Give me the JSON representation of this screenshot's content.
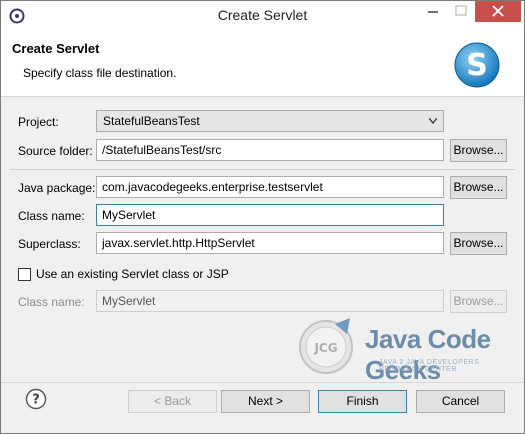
{
  "window": {
    "title": "Create Servlet"
  },
  "banner": {
    "title": "Create Servlet",
    "description": "Specify class file destination."
  },
  "form": {
    "project_label": "Project:",
    "project_value": "StatefulBeansTest",
    "source_folder_label": "Source folder:",
    "source_folder_value": "/StatefulBeansTest/src",
    "java_package_label": "Java package:",
    "java_package_value": "com.javacodegeeks.enterprise.testservlet",
    "class_name_label": "Class name:",
    "class_name_value": "MyServlet",
    "superclass_label": "Superclass:",
    "superclass_value": "javax.servlet.http.HttpServlet",
    "use_existing_label": "Use an existing Servlet class or JSP",
    "use_existing_checked": false,
    "existing_class_label": "Class name:",
    "existing_class_value": "MyServlet",
    "browse_label": "Browse..."
  },
  "watermark": {
    "badge": "JCG",
    "text": "Java Code Geeks",
    "subtext": "JAVA 2 JAVA DEVELOPERS RESOURCE CENTER"
  },
  "buttons": {
    "back": "< Back",
    "next": "Next >",
    "finish": "Finish",
    "cancel": "Cancel"
  },
  "icons": {
    "app": "eclipse-icon",
    "banner": "servlet-s-logo-icon",
    "help": "help-icon"
  }
}
